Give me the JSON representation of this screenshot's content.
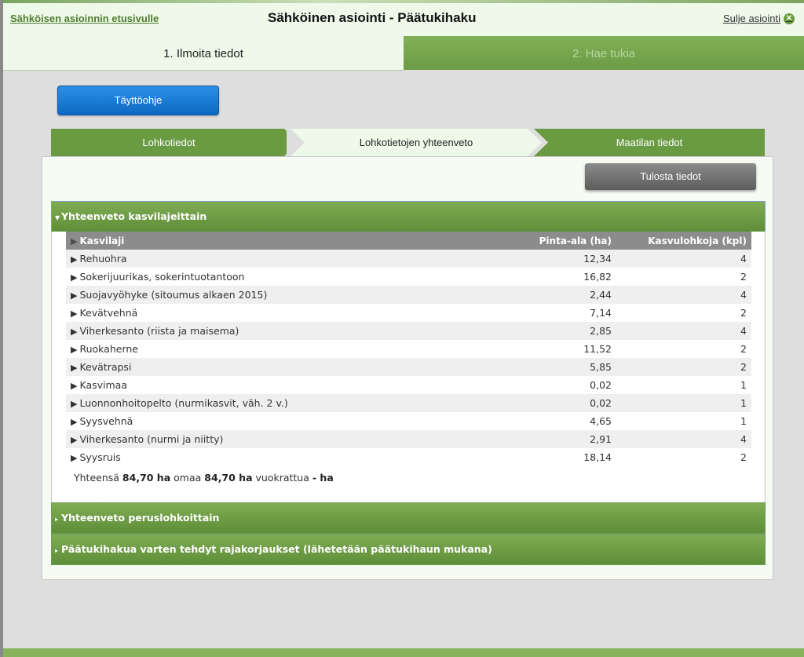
{
  "header": {
    "home_link": "Sähköisen asioinnin etusivulle",
    "title": "Sähköinen asiointi  -  Päätukihaku",
    "close_label": "Sulje asiointi"
  },
  "steps": [
    {
      "label": "1. Ilmoita tiedot"
    },
    {
      "label": "2. Hae tukia"
    }
  ],
  "help_button": "Täyttöohje",
  "subtabs": [
    {
      "label": "Lohkotiedot"
    },
    {
      "label": "Lohkotietojen yhteenveto"
    },
    {
      "label": "Maatilan tiedot"
    }
  ],
  "print_button": "Tulosta tiedot",
  "accordions": [
    {
      "label": "Yhteenveto kasvilajeittain"
    },
    {
      "label": "Yhteenveto peruslohkoittain"
    },
    {
      "label": "Päätukihakua varten tehdyt rajakorjaukset (lähetetään päätukihaun mukana)"
    }
  ],
  "table": {
    "columns": [
      "Kasvilaji",
      "Pinta-ala (ha)",
      "Kasvulohkoja (kpl)"
    ],
    "rows": [
      [
        "Rehuohra",
        "12,34",
        "4"
      ],
      [
        "Sokerijuurikas, sokerintuotantoon",
        "16,82",
        "2"
      ],
      [
        "Suojavyöhyke (sitoumus alkaen 2015)",
        "2,44",
        "4"
      ],
      [
        "Kevätvehnä",
        "7,14",
        "2"
      ],
      [
        "Viherkesanto (riista ja maisema)",
        "2,85",
        "4"
      ],
      [
        "Ruokaherne",
        "11,52",
        "2"
      ],
      [
        "Kevätrapsi",
        "5,85",
        "2"
      ],
      [
        "Kasvimaa",
        "0,02",
        "1"
      ],
      [
        "Luonnonhoitopelto (nurmikasvit, väh. 2 v.)",
        "0,02",
        "1"
      ],
      [
        "Syysvehnä",
        "4,65",
        "1"
      ],
      [
        "Viherkesanto (nurmi ja niitty)",
        "2,91",
        "4"
      ],
      [
        "Syysruis",
        "18,14",
        "2"
      ]
    ]
  },
  "summary": {
    "prefix": "Yhteensä",
    "total": "84,70 ha",
    "owned_label": "omaa",
    "owned": "84,70 ha",
    "rented_label": "vuokrattua",
    "rented": "- ha"
  },
  "colors": {
    "green": "#6a9a41",
    "blue_button": "#0d69c3",
    "light_bg": "#eef9ea"
  }
}
